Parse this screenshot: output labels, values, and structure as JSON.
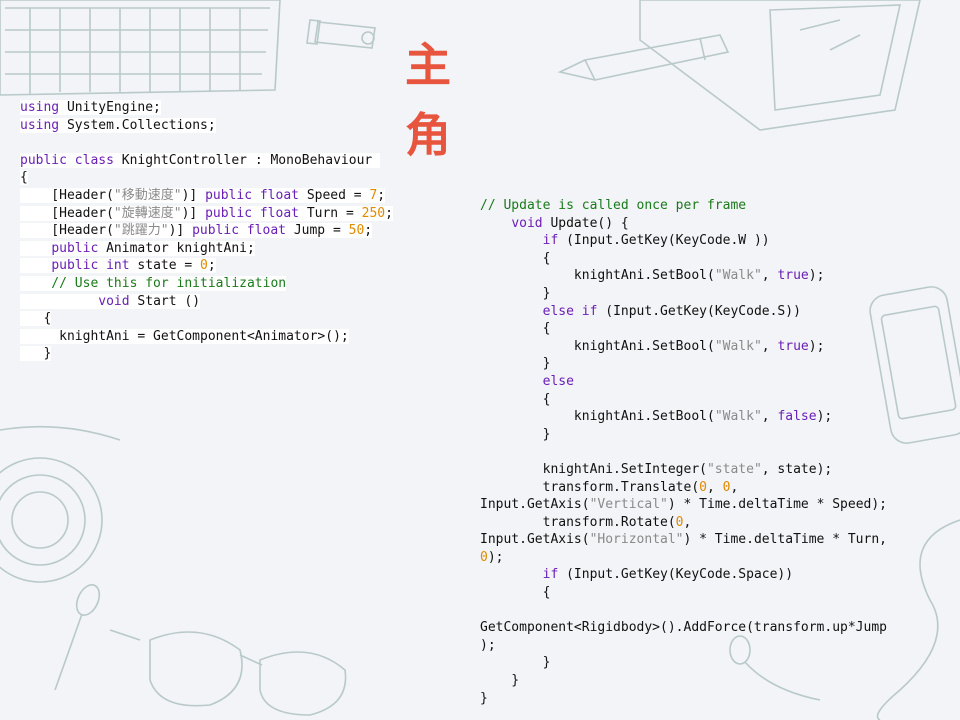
{
  "slide": {
    "title": "主 角",
    "accent_color": "#e8553e",
    "decor_icons": [
      "keyboard-icon",
      "usb-drive-icon",
      "pen-icon",
      "notebook-icon",
      "smartphone-icon",
      "coffee-cup-icon",
      "spoon-icon",
      "glasses-icon",
      "earphones-icon"
    ]
  },
  "code_left": [
    [
      [
        "kw",
        "using"
      ],
      [
        "pl",
        " UnityEngine;"
      ]
    ],
    [
      [
        "kw",
        "using"
      ],
      [
        "pl",
        " System.Collections;"
      ]
    ],
    [],
    [
      [
        "kw",
        "public"
      ],
      [
        "pl",
        " "
      ],
      [
        "kw",
        "class"
      ],
      [
        "pl",
        " KnightController : MonoBehaviour "
      ]
    ],
    [
      [
        "pl",
        "{"
      ]
    ],
    [
      [
        "pl",
        "    [Header("
      ],
      [
        "st",
        "\"移動速度\""
      ],
      [
        "pl",
        ")] "
      ],
      [
        "kw",
        "public"
      ],
      [
        "pl",
        " "
      ],
      [
        "kw",
        "float"
      ],
      [
        "pl",
        " Speed = "
      ],
      [
        "nm",
        "7"
      ],
      [
        "pl",
        ";"
      ]
    ],
    [
      [
        "pl",
        "    [Header("
      ],
      [
        "st",
        "\"旋轉速度\""
      ],
      [
        "pl",
        ")] "
      ],
      [
        "kw",
        "public"
      ],
      [
        "pl",
        " "
      ],
      [
        "kw",
        "float"
      ],
      [
        "pl",
        " Turn = "
      ],
      [
        "nm",
        "250"
      ],
      [
        "pl",
        ";"
      ]
    ],
    [
      [
        "pl",
        "    [Header("
      ],
      [
        "st",
        "\"跳躍力\""
      ],
      [
        "pl",
        ")] "
      ],
      [
        "kw",
        "public"
      ],
      [
        "pl",
        " "
      ],
      [
        "kw",
        "float"
      ],
      [
        "pl",
        " Jump = "
      ],
      [
        "nm",
        "50"
      ],
      [
        "pl",
        ";"
      ]
    ],
    [
      [
        "pl",
        "    "
      ],
      [
        "kw",
        "public"
      ],
      [
        "pl",
        " Animator knightAni;"
      ]
    ],
    [
      [
        "pl",
        "    "
      ],
      [
        "kw",
        "public"
      ],
      [
        "pl",
        " "
      ],
      [
        "kw",
        "int"
      ],
      [
        "pl",
        " state = "
      ],
      [
        "nm",
        "0"
      ],
      [
        "pl",
        ";"
      ]
    ],
    [
      [
        "cm",
        "    // Use this for initialization"
      ]
    ],
    [
      [
        "pl",
        "          "
      ],
      [
        "kw",
        "void"
      ],
      [
        "pl",
        " Start ()"
      ]
    ],
    [
      [
        "pl",
        "   {"
      ]
    ],
    [
      [
        "pl",
        "     knightAni = GetComponent<Animator>();"
      ]
    ],
    [
      [
        "pl",
        "   }"
      ]
    ]
  ],
  "code_right": [
    [
      [
        "cm",
        "// Update is called once per frame"
      ]
    ],
    [
      [
        "pl",
        "    "
      ],
      [
        "kw",
        "void"
      ],
      [
        "pl",
        " Update() {"
      ]
    ],
    [
      [
        "pl",
        "        "
      ],
      [
        "kw",
        "if"
      ],
      [
        "pl",
        " (Input.GetKey(KeyCode.W ))"
      ]
    ],
    [
      [
        "pl",
        "        {"
      ]
    ],
    [
      [
        "pl",
        "            knightAni.SetBool("
      ],
      [
        "st",
        "\"Walk\""
      ],
      [
        "pl",
        ", "
      ],
      [
        "kw",
        "true"
      ],
      [
        "pl",
        ");"
      ]
    ],
    [
      [
        "pl",
        "        }"
      ]
    ],
    [
      [
        "pl",
        "        "
      ],
      [
        "kw",
        "else"
      ],
      [
        "pl",
        " "
      ],
      [
        "kw",
        "if"
      ],
      [
        "pl",
        " (Input.GetKey(KeyCode.S))"
      ]
    ],
    [
      [
        "pl",
        "        {"
      ]
    ],
    [
      [
        "pl",
        "            knightAni.SetBool("
      ],
      [
        "st",
        "\"Walk\""
      ],
      [
        "pl",
        ", "
      ],
      [
        "kw",
        "true"
      ],
      [
        "pl",
        ");"
      ]
    ],
    [
      [
        "pl",
        "        }"
      ]
    ],
    [
      [
        "pl",
        "        "
      ],
      [
        "kw",
        "else"
      ]
    ],
    [
      [
        "pl",
        "        {"
      ]
    ],
    [
      [
        "pl",
        "            knightAni.SetBool("
      ],
      [
        "st",
        "\"Walk\""
      ],
      [
        "pl",
        ", "
      ],
      [
        "kw",
        "false"
      ],
      [
        "pl",
        ");"
      ]
    ],
    [
      [
        "pl",
        "        }"
      ]
    ],
    [],
    [
      [
        "pl",
        "        knightAni.SetInteger("
      ],
      [
        "st",
        "\"state\""
      ],
      [
        "pl",
        ", state);"
      ]
    ],
    [
      [
        "pl",
        "        transform.Translate("
      ],
      [
        "nm",
        "0"
      ],
      [
        "pl",
        ", "
      ],
      [
        "nm",
        "0"
      ],
      [
        "pl",
        ","
      ]
    ],
    [
      [
        "pl",
        "Input.GetAxis("
      ],
      [
        "st",
        "\"Vertical\""
      ],
      [
        "pl",
        ") * Time.deltaTime * Speed);"
      ]
    ],
    [
      [
        "pl",
        "        transform.Rotate("
      ],
      [
        "nm",
        "0"
      ],
      [
        "pl",
        ","
      ]
    ],
    [
      [
        "pl",
        "Input.GetAxis("
      ],
      [
        "st",
        "\"Horizontal\""
      ],
      [
        "pl",
        ") * Time.deltaTime * Turn,"
      ]
    ],
    [
      [
        "nm",
        "0"
      ],
      [
        "pl",
        ");"
      ]
    ],
    [
      [
        "pl",
        "        "
      ],
      [
        "kw",
        "if"
      ],
      [
        "pl",
        " (Input.GetKey(KeyCode.Space))"
      ]
    ],
    [
      [
        "pl",
        "        {"
      ]
    ],
    [],
    [
      [
        "pl",
        "GetComponent<Rigidbody>().AddForce(transform.up*Jump"
      ]
    ],
    [
      [
        "pl",
        ");"
      ]
    ],
    [
      [
        "pl",
        "        }"
      ]
    ],
    [
      [
        "pl",
        "    }"
      ]
    ],
    [
      [
        "pl",
        "}"
      ]
    ]
  ]
}
